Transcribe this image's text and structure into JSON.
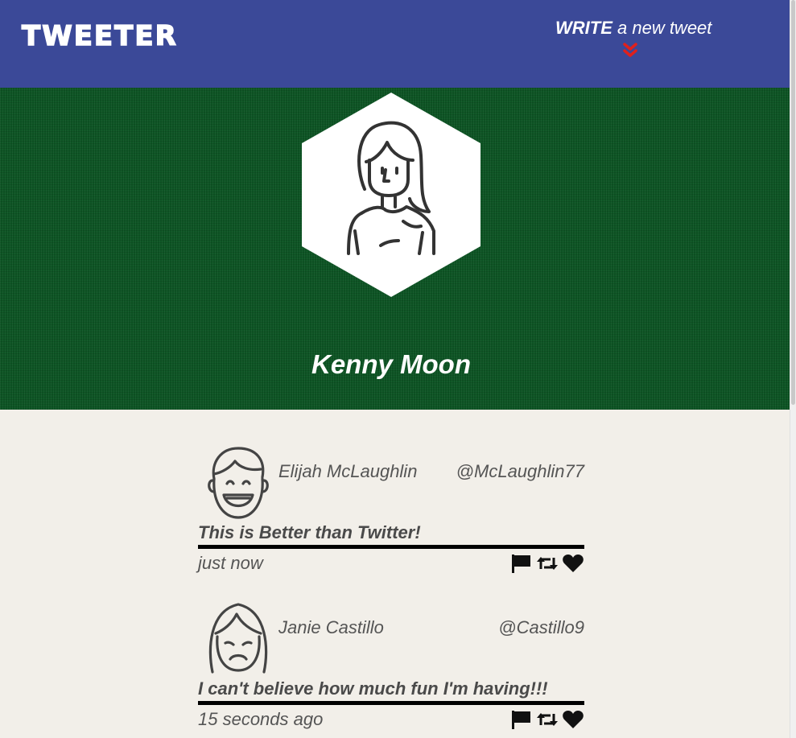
{
  "nav": {
    "brand": "TWEETER",
    "compose_strong": "WRITE",
    "compose_rest": " a new tweet",
    "compose_icon": "double-chevron-down-icon",
    "accent_color": "#e0201c",
    "background": "#3b4998"
  },
  "profile": {
    "name": "Kenny Moon",
    "avatar_icon": "user-avatar-icon",
    "background": "#0d5424"
  },
  "tweets": [
    {
      "author": "Elijah McLaughlin",
      "handle": "@McLaughlin77",
      "content": "This is Better than Twitter!",
      "time": "just now",
      "avatar_icon": "laughing-boy-avatar-icon"
    },
    {
      "author": "Janie Castillo",
      "handle": "@Castillo9",
      "content": "I can't believe how much fun I'm having!!!",
      "time": "15 seconds ago",
      "avatar_icon": "sad-girl-avatar-icon"
    }
  ],
  "actions": [
    "flag-icon",
    "retweet-icon",
    "heart-icon"
  ]
}
